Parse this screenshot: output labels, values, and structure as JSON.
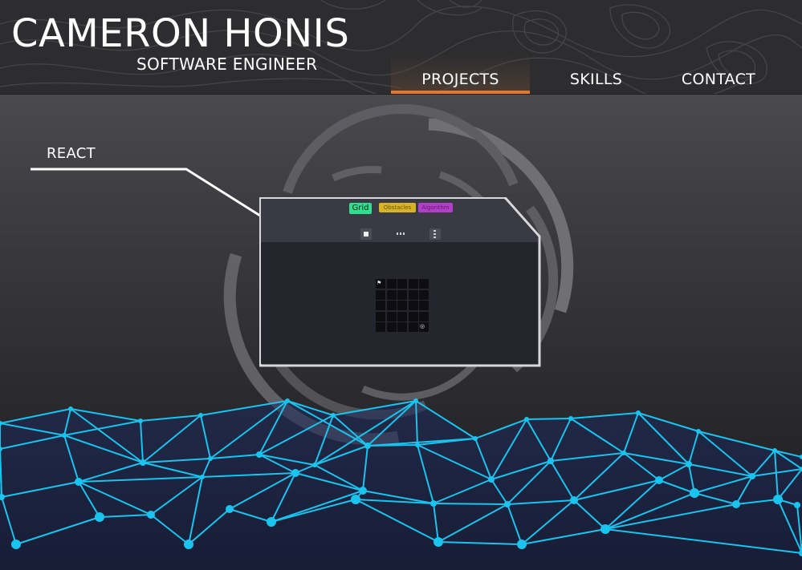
{
  "header": {
    "title": "CAMERON HONIS",
    "subtitle": "SOFTWARE ENGINEER"
  },
  "nav": {
    "items": [
      {
        "label": "PROJECTS",
        "active": true
      },
      {
        "label": "SKILLS",
        "active": false
      },
      {
        "label": "CONTACT",
        "active": false
      }
    ]
  },
  "project": {
    "label": "REACT",
    "preview": {
      "tabs": [
        "Grid",
        "Obstacles",
        "Algorithm"
      ],
      "tools": [
        "single-cell-icon",
        "row-icon",
        "column-icon"
      ],
      "start_icon": "flag-icon",
      "target_icon": "target-icon"
    }
  },
  "colors": {
    "accent": "#e8772e",
    "network": "#19c4ee",
    "tab_grid": "#2ee08e",
    "tab_obstacles": "#d8b325",
    "tab_algorithm": "#b33fc9"
  }
}
